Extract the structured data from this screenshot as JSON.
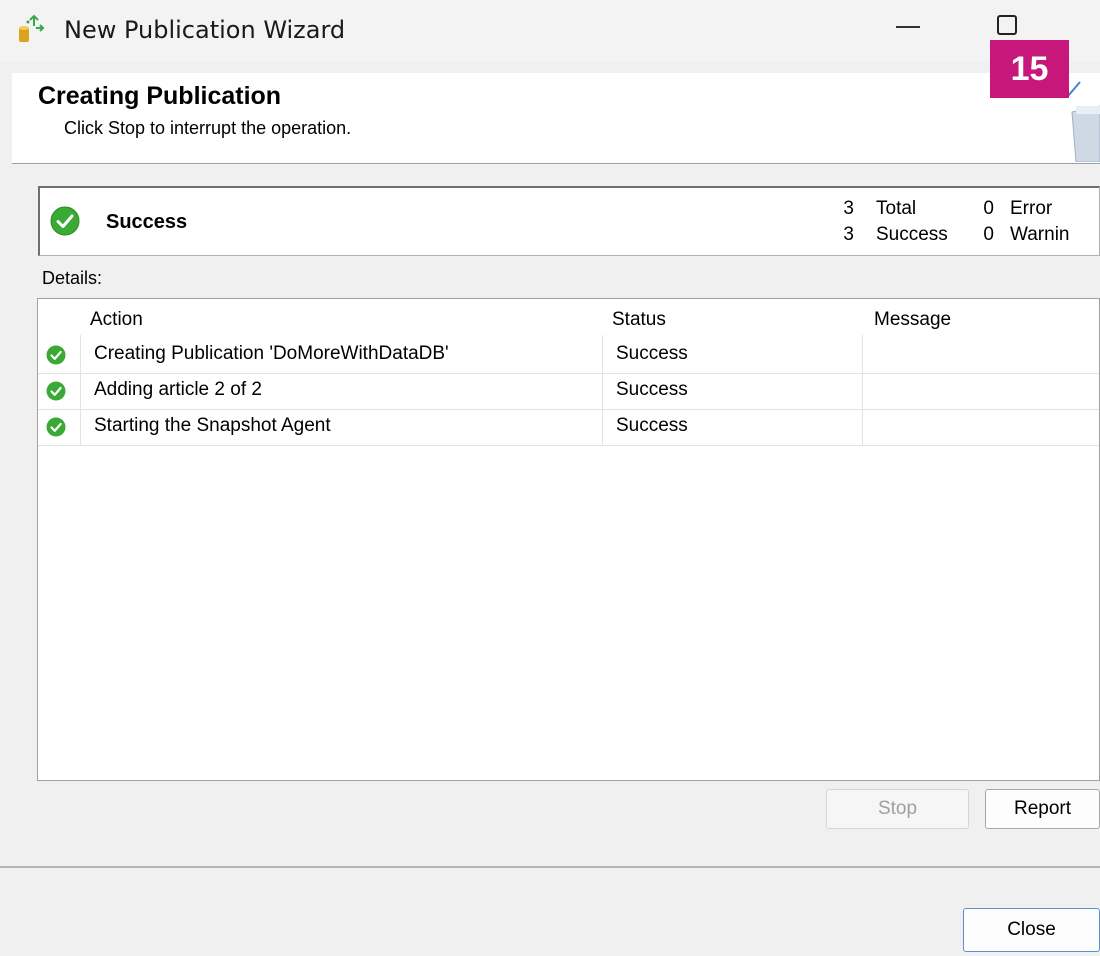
{
  "window": {
    "title": "New Publication Wizard"
  },
  "badge": "15",
  "header": {
    "title": "Creating Publication",
    "subtitle": "Click Stop to interrupt the operation."
  },
  "summary": {
    "status": "Success",
    "total_count": "3",
    "total_label": "Total",
    "success_count": "3",
    "success_label": "Success",
    "error_count": "0",
    "error_label": "Error",
    "warning_count": "0",
    "warning_label": "Warnin"
  },
  "details_label": "Details:",
  "table": {
    "columns": [
      "Action",
      "Status",
      "Message"
    ],
    "rows": [
      {
        "action": "Creating Publication 'DoMoreWithDataDB'",
        "status": "Success",
        "message": ""
      },
      {
        "action": "Adding article 2 of 2",
        "status": "Success",
        "message": ""
      },
      {
        "action": "Starting the Snapshot Agent",
        "status": "Success",
        "message": ""
      }
    ]
  },
  "buttons": {
    "stop": "Stop",
    "report": "Report",
    "close": "Close"
  },
  "colors": {
    "badge": "#c8177a",
    "success_green": "#3aa935"
  },
  "icons": {
    "app": "publication-wizard-icon",
    "status": "success-check-icon"
  }
}
